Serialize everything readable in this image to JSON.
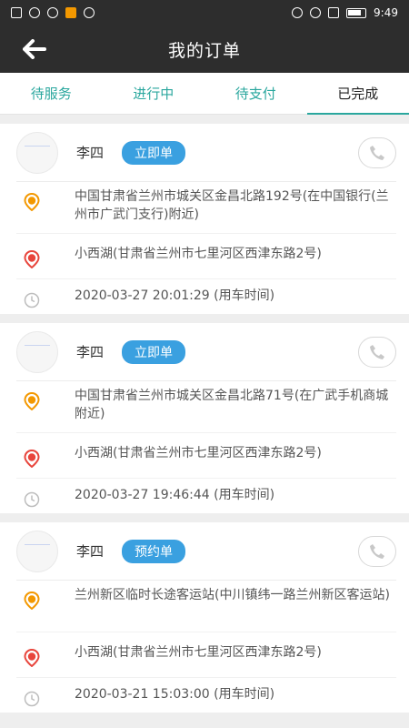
{
  "status_bar": {
    "time": "9:49"
  },
  "app_bar": {
    "title": "我的订单",
    "back_icon": "arrow-left-icon"
  },
  "tabs": [
    {
      "label": "待服务",
      "active": false
    },
    {
      "label": "进行中",
      "active": false
    },
    {
      "label": "待支付",
      "active": false
    },
    {
      "label": "已完成",
      "active": true
    }
  ],
  "orders": [
    {
      "name": "李四",
      "type": "立即单",
      "from": "中国甘肃省兰州市城关区金昌北路192号(在中国银行(兰州市广武门支行)附近)",
      "to": "小西湖(甘肃省兰州市七里河区西津东路2号)",
      "time": "2020-03-27 20:01:29 (用车时间)"
    },
    {
      "name": "李四",
      "type": "立即单",
      "from": "中国甘肃省兰州市城关区金昌北路71号(在广武手机商城附近)",
      "to": "小西湖(甘肃省兰州市七里河区西津东路2号)",
      "time": "2020-03-27 19:46:44 (用车时间)"
    },
    {
      "name": "李四",
      "type": "预约单",
      "from": "兰州新区临时长途客运站(中川镇纬一路兰州新区客运站)",
      "to": "小西湖(甘肃省兰州市七里河区西津东路2号)",
      "time": "2020-03-21 15:03:00 (用车时间)"
    }
  ],
  "icons": {
    "pickup": "pickup-pin-icon",
    "dropoff": "dropoff-pin-icon",
    "time": "clock-icon",
    "call": "phone-icon"
  },
  "colors": {
    "accent": "#2aa79e",
    "badge": "#3aa0e0",
    "pickup": "#f39800",
    "dropoff": "#e8453c"
  }
}
